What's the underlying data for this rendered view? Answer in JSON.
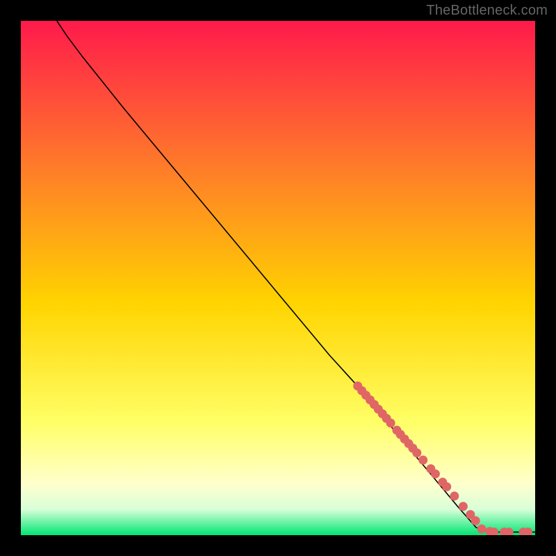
{
  "attribution": "TheBottleneck.com",
  "colors": {
    "gradient_top": "#ff1a4b",
    "gradient_mid1": "#ff7a2a",
    "gradient_mid2": "#ffd400",
    "gradient_mid3": "#ffff66",
    "gradient_mid4": "#ffffcc",
    "gradient_mid5": "#d8ffd8",
    "gradient_bottom": "#00e673",
    "curve": "#000000",
    "marker": "#e06666",
    "frame": "#000000"
  },
  "chart_data": {
    "type": "line",
    "title": "",
    "xlabel": "",
    "ylabel": "",
    "xlim": [
      0,
      100
    ],
    "ylim": [
      0,
      100
    ],
    "curve": [
      {
        "x": 7,
        "y": 100
      },
      {
        "x": 9,
        "y": 97
      },
      {
        "x": 12,
        "y": 93
      },
      {
        "x": 16,
        "y": 88
      },
      {
        "x": 20,
        "y": 83
      },
      {
        "x": 25,
        "y": 77
      },
      {
        "x": 30,
        "y": 71
      },
      {
        "x": 35,
        "y": 65
      },
      {
        "x": 40,
        "y": 59
      },
      {
        "x": 45,
        "y": 53
      },
      {
        "x": 50,
        "y": 47
      },
      {
        "x": 55,
        "y": 41
      },
      {
        "x": 60,
        "y": 35
      },
      {
        "x": 65,
        "y": 29.5
      },
      {
        "x": 70,
        "y": 23.5
      },
      {
        "x": 75,
        "y": 17.5
      },
      {
        "x": 80,
        "y": 11.5
      },
      {
        "x": 85,
        "y": 5.5
      },
      {
        "x": 88.5,
        "y": 1.5
      },
      {
        "x": 90,
        "y": 0.8
      },
      {
        "x": 92,
        "y": 0.6
      },
      {
        "x": 95,
        "y": 0.6
      },
      {
        "x": 100,
        "y": 0.6
      }
    ],
    "series": [
      {
        "name": "highlighted-points",
        "points": [
          {
            "x": 65.5,
            "y": 29
          },
          {
            "x": 66.3,
            "y": 28.1
          },
          {
            "x": 67.1,
            "y": 27.2
          },
          {
            "x": 67.9,
            "y": 26.3
          },
          {
            "x": 68.7,
            "y": 25.4
          },
          {
            "x": 69.5,
            "y": 24.5
          },
          {
            "x": 70.3,
            "y": 23.6
          },
          {
            "x": 71.1,
            "y": 22.7
          },
          {
            "x": 71.9,
            "y": 21.8
          },
          {
            "x": 73.1,
            "y": 20.4
          },
          {
            "x": 73.8,
            "y": 19.6
          },
          {
            "x": 74.6,
            "y": 18.7
          },
          {
            "x": 75.4,
            "y": 17.8
          },
          {
            "x": 76.2,
            "y": 16.9
          },
          {
            "x": 77.0,
            "y": 16.0
          },
          {
            "x": 78.2,
            "y": 14.6
          },
          {
            "x": 79.7,
            "y": 12.9
          },
          {
            "x": 80.6,
            "y": 11.9
          },
          {
            "x": 82.0,
            "y": 10.3
          },
          {
            "x": 82.8,
            "y": 9.4
          },
          {
            "x": 84.3,
            "y": 7.6
          },
          {
            "x": 86.0,
            "y": 5.6
          },
          {
            "x": 87.4,
            "y": 4.0
          },
          {
            "x": 88.4,
            "y": 2.8
          },
          {
            "x": 89.6,
            "y": 1.2
          },
          {
            "x": 91.2,
            "y": 0.7
          },
          {
            "x": 92.0,
            "y": 0.6
          },
          {
            "x": 94.0,
            "y": 0.6
          },
          {
            "x": 94.9,
            "y": 0.6
          },
          {
            "x": 97.7,
            "y": 0.6
          },
          {
            "x": 98.6,
            "y": 0.6
          }
        ]
      }
    ]
  }
}
